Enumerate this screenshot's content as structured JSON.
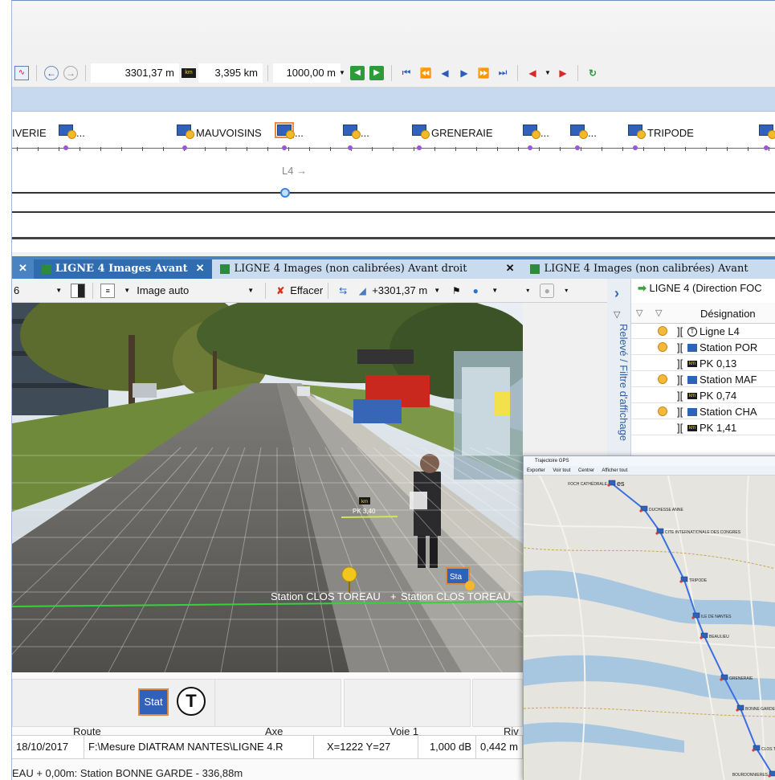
{
  "toolbar": {
    "position_m": "3301,37 m",
    "position_km": "3,395 km",
    "step": "1000,00 m",
    "km_icon": "km"
  },
  "line_strip": {
    "stations": [
      "IVERIE",
      "MAUVOISINS",
      "GRENERAIE",
      "TRIPODE"
    ],
    "ellipsis": "...",
    "line_label": "L4",
    "arrow": "→"
  },
  "tabs": [
    {
      "label": "LIGNE 4  Images Avant",
      "active": true
    },
    {
      "label": "LIGNE 4  Images (non calibrées) Avant droit",
      "active": false
    },
    {
      "label": "LIGNE 4  Images (non calibrées) Avant",
      "active": false
    }
  ],
  "image_toolbar": {
    "left_fragment": "6",
    "image_mode": "Image auto",
    "clear_label": "Effacer",
    "offset": "+3301,37 m"
  },
  "photo": {
    "pk_marker": "PK 3,40",
    "station_label_1": "Station CLOS TOREAU",
    "station_label_2": "Station CLOS TOREAU",
    "plus": "+",
    "station_icon_text": "Sta",
    "km_text": "km"
  },
  "side_panel": {
    "vertical_label": "Relevé / Filtre d'affichage",
    "chevron": "›"
  },
  "list_panel": {
    "header": "LIGNE 4 (Direction FOC",
    "column": "Désignation",
    "rows": [
      {
        "mark": true,
        "type": "tram",
        "label": "Ligne L4"
      },
      {
        "mark": true,
        "type": "station",
        "label": "Station  POR"
      },
      {
        "mark": false,
        "type": "km",
        "label": "PK 0,13"
      },
      {
        "mark": true,
        "type": "station",
        "label": "Station  MAF"
      },
      {
        "mark": false,
        "type": "km",
        "label": "PK 0,74"
      },
      {
        "mark": true,
        "type": "station",
        "label": "Station  CHA"
      },
      {
        "mark": false,
        "type": "km",
        "label": "PK 1,41"
      }
    ],
    "bracket": "]["
  },
  "bottom_panel": {
    "card_station_text": "Stat",
    "tram_symbol": "T",
    "columns": [
      "Route",
      "Axe",
      "Voie 1",
      "Riv"
    ],
    "status": {
      "date": "18/10/2017",
      "path": "F:\\Mesure DIATRAM NANTES\\LIGNE 4.R",
      "coords": "X=1222 Y=27",
      "db": "1,000 dB",
      "value": "0,442 m"
    },
    "footer": "EAU + 0,00m: Station BONNE GARDE - 336,88m"
  },
  "gps": {
    "title": "Trajectoire GPS",
    "toolbar": [
      "Exporter",
      "Voir tout",
      "Centrer",
      "Afficher tout"
    ],
    "places": [
      "FOCH CATHÉDRALE",
      "DUCHESSE ANNE",
      "CITE INTERNATIONALE DES CONGRES",
      "TRIPODE",
      "ILE DE NANTES",
      "BEAULIEU",
      "GRENERAIE",
      "BONNE GARDE",
      "CLOS TOR",
      "BOURDONNIERES"
    ],
    "es_fragment": "es"
  },
  "colors": {
    "tab_bar": "#4a83c2",
    "active_tab": "#2f6cb0",
    "station_icon": "#2f62b8",
    "route_line": "#3b6fe0"
  }
}
